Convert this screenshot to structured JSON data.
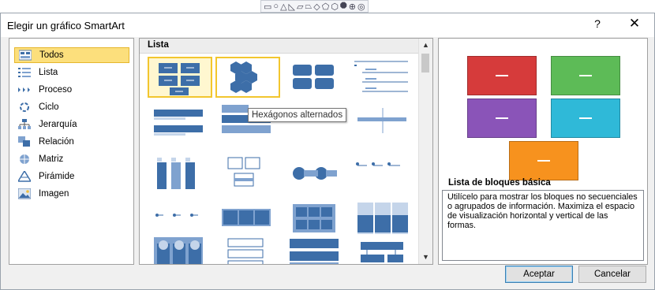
{
  "dialog": {
    "title": "Elegir un gráfico SmartArt",
    "help_label": "?",
    "close_label": "✕"
  },
  "top_toolbar": {
    "icons": [
      "shape-rect-icon",
      "shape-oval-icon",
      "shape-triangle-icon",
      "shape-right-triangle-icon",
      "shape-parallelogram-icon",
      "shape-trapezoid-icon",
      "shape-diamond-icon",
      "shape-pentagon-icon",
      "shape-hexagon-icon",
      "shape-octagon-icon",
      "shape-circle-plus-icon",
      "shape-donut-icon"
    ]
  },
  "categories": [
    {
      "label": "Todos",
      "icon": "all-icon",
      "selected": true
    },
    {
      "label": "Lista",
      "icon": "list-icon",
      "selected": false
    },
    {
      "label": "Proceso",
      "icon": "process-icon",
      "selected": false
    },
    {
      "label": "Ciclo",
      "icon": "cycle-icon",
      "selected": false
    },
    {
      "label": "Jerarquía",
      "icon": "hierarchy-icon",
      "selected": false
    },
    {
      "label": "Relación",
      "icon": "relationship-icon",
      "selected": false
    },
    {
      "label": "Matriz",
      "icon": "matrix-icon",
      "selected": false
    },
    {
      "label": "Pirámide",
      "icon": "pyramid-icon",
      "selected": false
    },
    {
      "label": "Imagen",
      "icon": "picture-icon",
      "selected": false
    }
  ],
  "gallery": {
    "header": "Lista",
    "tooltip": "Hexágonos alternados",
    "items": [
      {
        "name": "Lista de bloques básica",
        "selected": true
      },
      {
        "name": "Hexágonos alternados",
        "hover": true
      },
      {
        "name": "thumb-3"
      },
      {
        "name": "thumb-4"
      },
      {
        "name": "thumb-5"
      },
      {
        "name": "thumb-6"
      },
      {
        "name": "thumb-7"
      },
      {
        "name": "thumb-8"
      },
      {
        "name": "thumb-9"
      },
      {
        "name": "thumb-10"
      },
      {
        "name": "thumb-11"
      },
      {
        "name": "thumb-12"
      },
      {
        "name": "thumb-13"
      },
      {
        "name": "thumb-14"
      },
      {
        "name": "thumb-15"
      },
      {
        "name": "thumb-16"
      },
      {
        "name": "thumb-17"
      },
      {
        "name": "thumb-18"
      },
      {
        "name": "thumb-19"
      },
      {
        "name": "thumb-20"
      }
    ]
  },
  "preview": {
    "title": "Lista de bloques básica",
    "description": "Utilícelo para mostrar los bloques no secuenciales o agrupados de información. Maximiza el espacio de visualización horizontal y vertical de las formas.",
    "block_colors": [
      "#d63b3b",
      "#5dbb57",
      "#8a54b8",
      "#2fb9d8",
      "#f7921e"
    ]
  },
  "buttons": {
    "ok": "Aceptar",
    "cancel": "Cancelar"
  },
  "colors": {
    "selection": "#fcdf7c",
    "smartart_blue": "#3d6ea8"
  }
}
